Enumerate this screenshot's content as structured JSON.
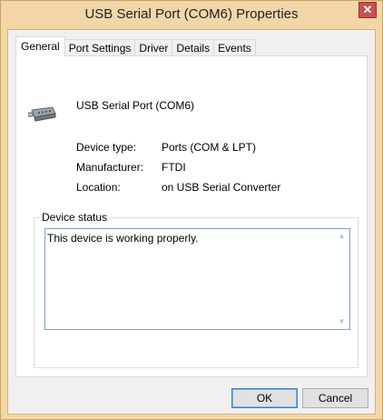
{
  "window": {
    "title": "USB Serial Port (COM6) Properties",
    "close_glyph": "✕"
  },
  "tabs": [
    {
      "label": "General",
      "active": true
    },
    {
      "label": "Port Settings",
      "active": false
    },
    {
      "label": "Driver",
      "active": false
    },
    {
      "label": "Details",
      "active": false
    },
    {
      "label": "Events",
      "active": false
    }
  ],
  "general": {
    "device_name": "USB Serial Port (COM6)",
    "device_icon": "serial-port-icon",
    "properties": [
      {
        "label": "Device type:",
        "value": "Ports (COM & LPT)"
      },
      {
        "label": "Manufacturer:",
        "value": "FTDI"
      },
      {
        "label": "Location:",
        "value": "on USB Serial Converter"
      }
    ],
    "status_group_label": "Device status",
    "status_text": "This device is working properly."
  },
  "buttons": {
    "ok": "OK",
    "cancel": "Cancel"
  },
  "colors": {
    "title_bar": "#f2d6a8",
    "close_button": "#c75050",
    "status_border": "#7a9ed1",
    "default_button_border": "#3c7fb1"
  }
}
